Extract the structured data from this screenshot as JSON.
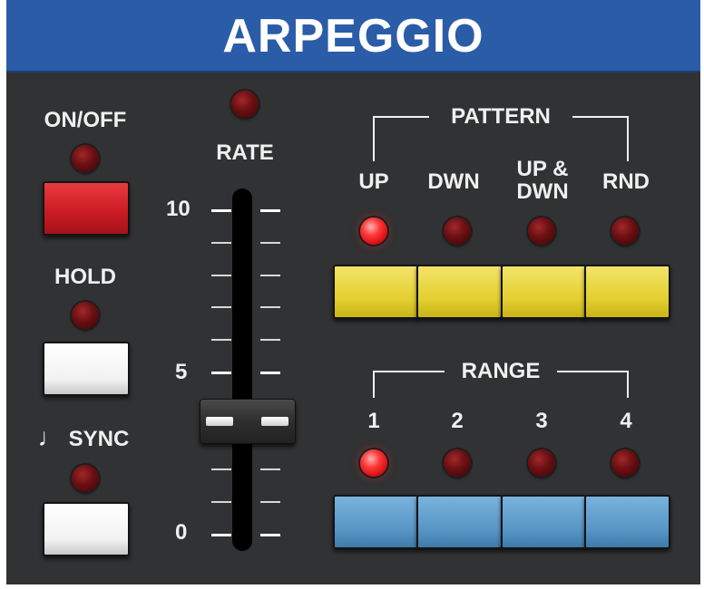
{
  "header": {
    "title": "ARPEGGIO"
  },
  "onoff": {
    "label": "ON/OFF",
    "led_on": false
  },
  "hold": {
    "label": "HOLD",
    "led_on": false
  },
  "sync": {
    "label": "SYNC",
    "note_symbol": "♩",
    "led_on": false
  },
  "rate": {
    "label": "RATE",
    "led_on": false,
    "scale": {
      "max_label": "10",
      "mid_label": "5",
      "min_label": "0"
    },
    "value": 3.5
  },
  "pattern": {
    "title": "PATTERN",
    "options": [
      {
        "label": "UP",
        "led_on": true
      },
      {
        "label": "DWN",
        "led_on": false
      },
      {
        "label": "UP &\nDWN",
        "led_on": false
      },
      {
        "label": "RND",
        "led_on": false
      }
    ]
  },
  "range": {
    "title": "RANGE",
    "options": [
      {
        "label": "1",
        "led_on": true
      },
      {
        "label": "2",
        "led_on": false
      },
      {
        "label": "3",
        "led_on": false
      },
      {
        "label": "4",
        "led_on": false
      }
    ]
  },
  "colors": {
    "header_blue": "#2a5ca8",
    "panel": "#313233",
    "led_on": "#ff3a3a",
    "pattern_button": "#e3cf2e",
    "range_button": "#5796c6",
    "onoff_button": "#c91a22"
  }
}
